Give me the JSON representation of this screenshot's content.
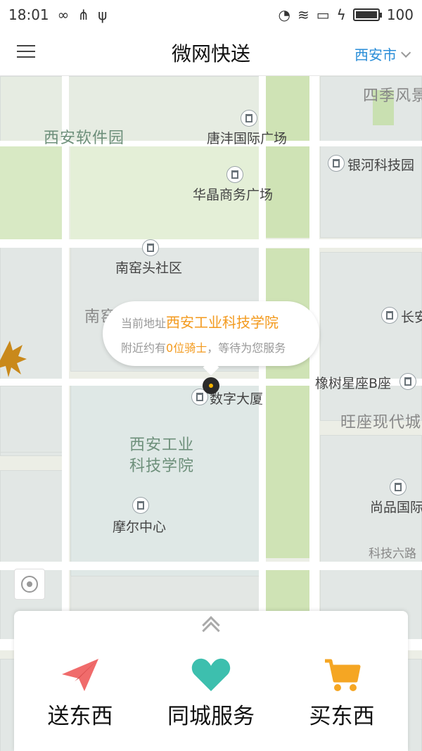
{
  "status_bar": {
    "time": "18:01",
    "battery": "100"
  },
  "header": {
    "title": "微网快送",
    "city": "西安市"
  },
  "map": {
    "labels": {
      "siji": "四季风景",
      "xian_software_park": "西安软件园",
      "tangfeng": "唐沣国际广场",
      "yinhe": "银河科技园",
      "huajing": "华晶商务广场",
      "nanyaotou": "南窑头社区",
      "nanyao_partial": "南窑",
      "changan_partial": "长安",
      "xiangshu": "橡树星座B座",
      "wangzuo": "旺座现代城",
      "shuzi": "数字大厦",
      "xigong_1": "西安工业",
      "xigong_2": "科技学院",
      "shangpin": "尚品国际",
      "moer": "摩尔中心",
      "keji6": "科技六路"
    }
  },
  "popup": {
    "prefix": "当前地址",
    "address": "西安工业科技学院",
    "riders_prefix": "附近约有",
    "riders_count": "0位骑士",
    "riders_suffix": "，等待为您服务"
  },
  "services": [
    {
      "label": "送东西",
      "icon": "paper-plane-icon",
      "color": "#f06b6b"
    },
    {
      "label": "同城服务",
      "icon": "heart-icon",
      "color": "#3dbfae"
    },
    {
      "label": "买东西",
      "icon": "cart-icon",
      "color": "#f5a623"
    }
  ]
}
